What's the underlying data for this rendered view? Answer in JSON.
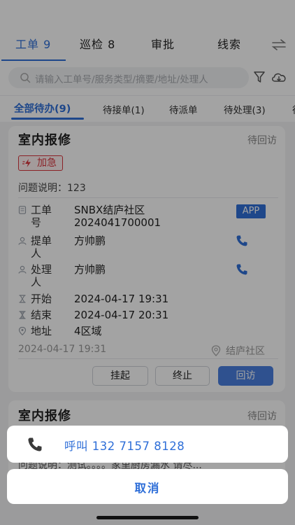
{
  "main_tabs": [
    {
      "label": "工单 9"
    },
    {
      "label": "巡检 8"
    },
    {
      "label": "审批"
    },
    {
      "label": "线索"
    }
  ],
  "search": {
    "placeholder": "请输入工单号/服务类型/摘要/地址/处理人"
  },
  "sub_tabs": [
    {
      "label": "全部待办(9)"
    },
    {
      "label": "待接单(1)"
    },
    {
      "label": "待派单"
    },
    {
      "label": "待处理(3)"
    },
    {
      "label": "待"
    }
  ],
  "card1": {
    "title": "室内报修",
    "status": "待回访",
    "urgent_label": "加急",
    "description": "问题说明：123",
    "order_label_1": "工单",
    "order_label_2": "号",
    "order_value_1": "SNBX结庐社区",
    "order_value_2": "2024041700001",
    "app_badge": "APP",
    "submitter_label_1": "提单",
    "submitter_label_2": "人",
    "submitter_value": "方帅鹏",
    "handler_label_1": "处理",
    "handler_label_2": "人",
    "handler_value": "方帅鹏",
    "start_label": "开始",
    "start_value": "2024-04-17 19:31",
    "end_label": "结束",
    "end_value": "2024-04-17 20:31",
    "address_label": "地址",
    "address_value": "4区域",
    "footer_time": "2024-04-17 19:31",
    "footer_location": "结庐社区",
    "buttons": {
      "suspend": "挂起",
      "terminate": "终止",
      "revisit": "回访"
    }
  },
  "card2": {
    "title": "室内报修",
    "status": "待回访",
    "description_partial": "问题说明：测试。。。。家里厨房漏水 请尽..."
  },
  "action_sheet": {
    "call_text": "呼叫 132 7157 8128",
    "cancel_text": "取消"
  },
  "colors": {
    "accent": "#2f6fd8",
    "urgent": "#d9363e",
    "primary_button": "#4a7fe0"
  },
  "icons": [
    "swap-icon",
    "search-icon",
    "filter-icon",
    "cloud-download-icon",
    "bolt-icon",
    "document-icon",
    "user-icon",
    "hourglass-icon",
    "location-pin-icon",
    "phone-icon"
  ]
}
